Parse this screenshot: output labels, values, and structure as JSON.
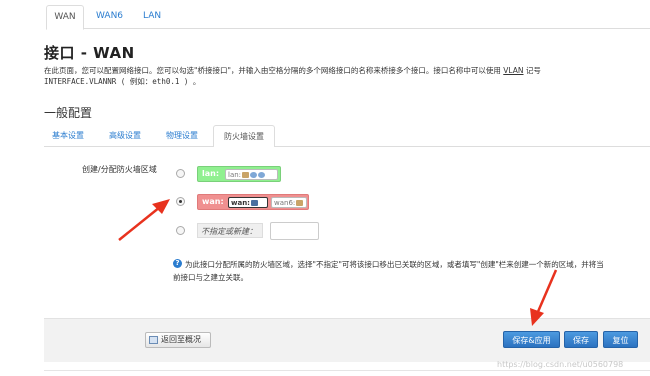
{
  "top_tabs": [
    {
      "label": "WAN"
    },
    {
      "label": "WAN6"
    },
    {
      "label": "LAN"
    }
  ],
  "page": {
    "title": "接口 - WAN",
    "desc_line1": "在此页面，您可以配置网络接口。您可以勾选\"桥接接口\"，并输入由空格分隔的多个网络接口的名称来桥接多个接口。接口名称中可以使用 ",
    "desc_vlan": "VLAN",
    "desc_line1_end": " 记号",
    "desc_line2": "INTERFACE.VLANNR ( 例如：eth0.1 ) 。"
  },
  "section": {
    "title": "一般配置",
    "tabs": [
      {
        "label": "基本设置"
      },
      {
        "label": "高级设置"
      },
      {
        "label": "物理设置"
      },
      {
        "label": "防火墙设置"
      }
    ]
  },
  "firewall": {
    "field_label": "创建/分配防火墙区域",
    "zones": [
      {
        "name": "lan:",
        "networks": [
          "lan:"
        ],
        "color": "#90f090",
        "checked": false
      },
      {
        "name": "wan:",
        "networks": [
          "wan:",
          "wan6:"
        ],
        "color": "#f09090",
        "checked": true
      }
    ],
    "new_zone_label": "不指定或新建：",
    "new_zone_value": "",
    "help_line1": "为此接口分配所属的防火墙区域，选择\"不指定\"可将该接口移出已关联的区域，或者填写\"创建\"栏来创建一个新的区域，并将当",
    "help_line2": "前接口与之建立关联。"
  },
  "footer": {
    "back_label": "返回至概况",
    "apply_label": "保存&应用",
    "save_label": "保存",
    "reset_label": "复位"
  },
  "watermark": "https://blog.csdn.net/u0560798",
  "colors": {
    "link": "#2a7ccf",
    "button": "#2c72c0",
    "arrow": "#e8321e"
  }
}
